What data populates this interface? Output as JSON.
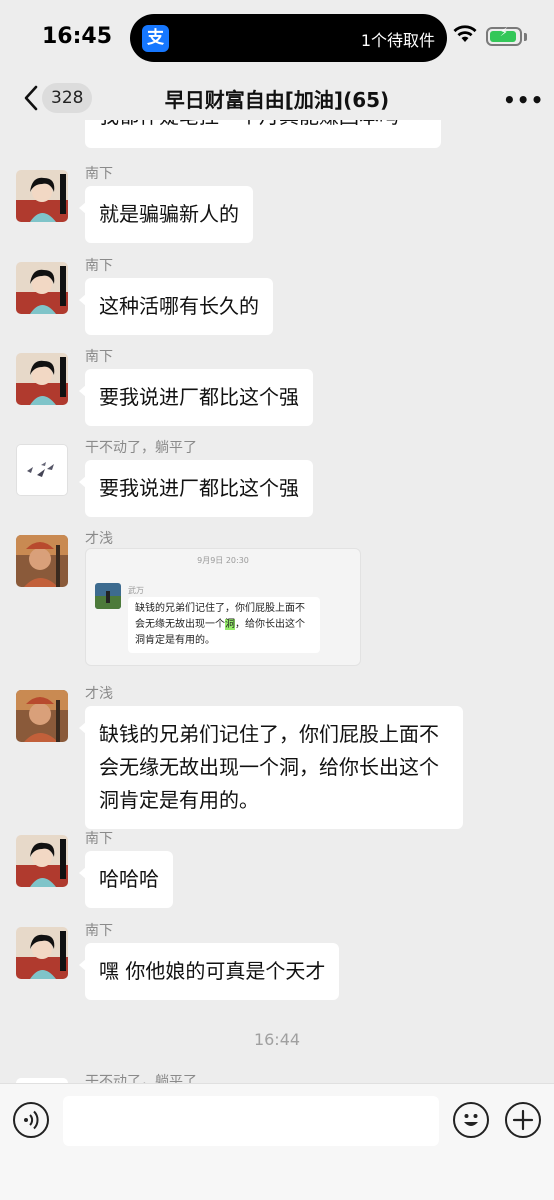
{
  "status_bar": {
    "time": "16:45",
    "island_app_glyph": "支",
    "island_text": "1个待取件",
    "wifi_icon": "wifi-icon",
    "battery_icon": "battery-charging-icon"
  },
  "nav": {
    "back_icon": "chevron-left-icon",
    "back_count": "328",
    "title": "早日财富自由[加油](65)",
    "more_label": "•••"
  },
  "partial_top_text": "我都怀疑笔挂一个月真能赚回本吗",
  "messages": [
    {
      "sender": "南下",
      "text": "就是骗骗新人的"
    },
    {
      "sender": "南下",
      "text": "这种活哪有长久的"
    },
    {
      "sender": "南下",
      "text": "要我说进厂都比这个强"
    },
    {
      "sender": "干不动了，躺平了",
      "text": "要我说进厂都比这个强"
    },
    {
      "sender": "才浅",
      "screenshot": {
        "time": "9月9日 20:30",
        "name": "武万",
        "text_before": "缺钱的兄弟们记住了，你们屁股上面不会无缘无故出现一个",
        "text_highlight": "洞",
        "text_after": "，给你长出这个洞肯定是有用的。"
      }
    },
    {
      "sender": "才浅",
      "text": "缺钱的兄弟们记住了，你们屁股上面不会无缘无故出现一个洞，给你长出这个洞肯定是有用的。"
    },
    {
      "sender": "南下",
      "text": "哈哈哈"
    },
    {
      "sender": "南下",
      "text": "嘿 你他娘的可真是个天才"
    }
  ],
  "timestamp": "16:44",
  "partial_bottom_sender": "干不动了，躺平了",
  "input_bar": {
    "voice_icon": "voice-icon",
    "emoji_icon": "emoji-icon",
    "plus_icon": "plus-icon",
    "placeholder": ""
  }
}
